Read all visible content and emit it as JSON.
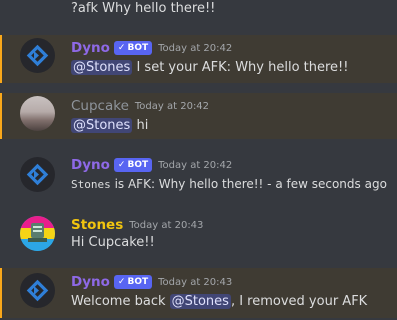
{
  "messages": [
    {
      "content": "?afk Why hello there!!"
    },
    {
      "author": "Dyno",
      "bot_label": "BOT",
      "bot_check": "✓",
      "timestamp": "Today at 20:42",
      "mention": "@Stones",
      "text": " I set your AFK: Why hello there!!"
    },
    {
      "author": "Cupcake",
      "timestamp": "Today at 20:42",
      "mention": "@Stones",
      "text": " hi"
    },
    {
      "author": "Dyno",
      "bot_label": "BOT",
      "bot_check": "✓",
      "timestamp": "Today at 20:42",
      "code": "Stones",
      "text": " is AFK: Why hello there!! - a few seconds ago"
    },
    {
      "author": "Stones",
      "timestamp": "Today at 20:43",
      "content": "Hi Cupcake!!"
    },
    {
      "author": "Dyno",
      "bot_label": "BOT",
      "bot_check": "✓",
      "timestamp": "Today at 20:43",
      "pre": "Welcome back ",
      "mention": "@Stones",
      "text": ", I removed your AFK"
    }
  ],
  "colors": {
    "dyno": "#8e69e6",
    "cupcake": "#8e949b",
    "stones": "#f1c40f",
    "mention_bg": "#414675",
    "highlight_bar": "#faa81a"
  }
}
